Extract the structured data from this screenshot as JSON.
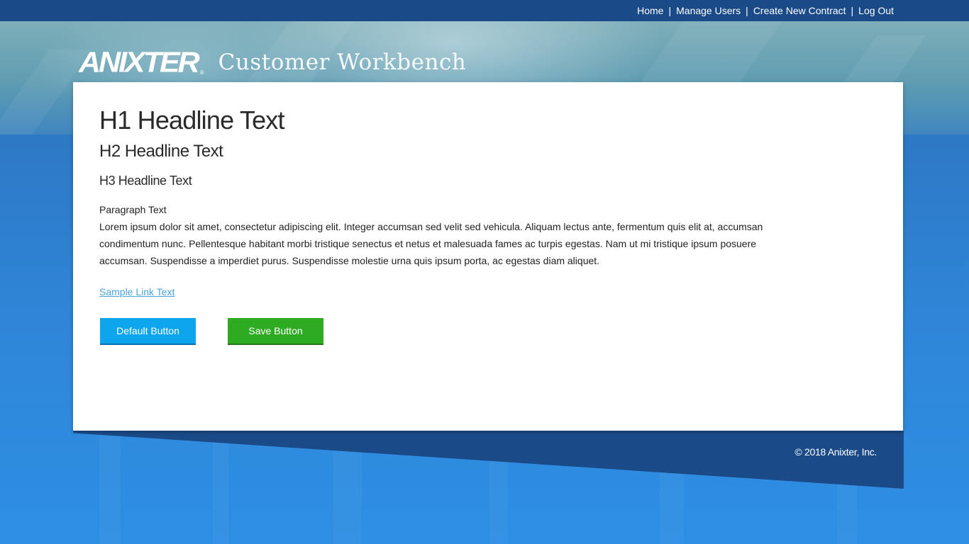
{
  "nav": {
    "home": "Home",
    "manage_users": "Manage Users",
    "create_contract": "Create New Contract",
    "log_out": "Log Out",
    "separator": "|"
  },
  "brand": {
    "logo_text": "ANIXTER",
    "trademark": "®",
    "app_title": "Customer Workbench"
  },
  "content": {
    "h1": "H1 Headline Text",
    "h2": "H2 Headline Text",
    "h3": "H3 Headline Text",
    "paragraph_label": "Paragraph Text",
    "paragraph_body": "Lorem ipsum dolor sit amet, consectetur adipiscing elit. Integer accumsan sed velit sed vehicula. Aliquam lectus ante, fermentum quis elit at, accumsan condimentum nunc. Pellentesque habitant morbi tristique senectus et netus et malesuada fames ac turpis egestas. Nam ut mi tristique ipsum posuere accumsan. Suspendisse a imperdiet purus. Suspendisse molestie urna quis ipsum porta, ac egestas diam aliquet.",
    "sample_link": "Sample Link Text"
  },
  "buttons": {
    "default_label": "Default Button",
    "save_label": "Save Button"
  },
  "footer": {
    "copyright": "© 2018 Anixter, Inc."
  },
  "colors": {
    "nav_bar": "#1b4a89",
    "default_button": "#0ea5ef",
    "save_button": "#2eab23",
    "link": "#4aa6e0"
  }
}
